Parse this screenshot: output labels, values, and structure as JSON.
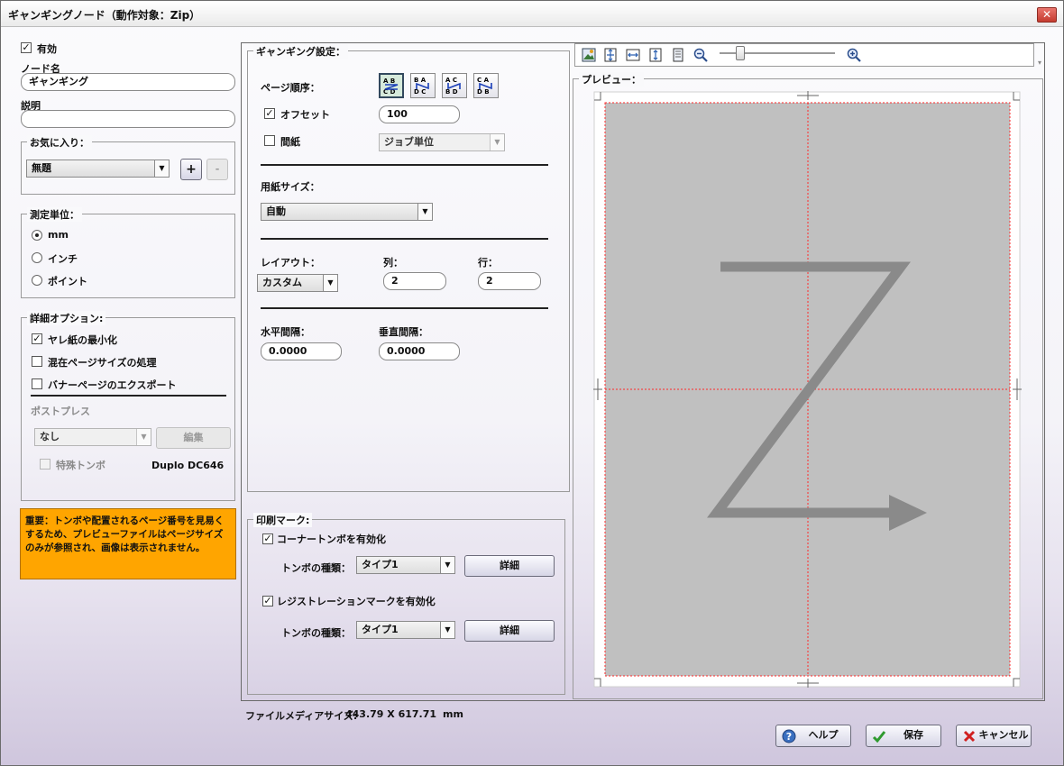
{
  "window": {
    "title": "ギャンギングノード（動作対象：Zip）",
    "close": "✕"
  },
  "left": {
    "enabled_label": "有効",
    "node_name_label": "ノード名",
    "node_name_value": "ギャンギング",
    "description_label": "説明",
    "description_value": "",
    "favorites": {
      "legend": "お気に入り：",
      "selected": "無題",
      "add": "+",
      "remove": "-"
    },
    "units": {
      "legend": "測定単位：",
      "options": [
        "mm",
        "インチ",
        "ポイント"
      ],
      "selected": "mm"
    },
    "advanced": {
      "legend": "詳細オプション:",
      "options": [
        {
          "label": "ヤレ紙の最小化",
          "checked": true
        },
        {
          "label": "混在ページサイズの処理",
          "checked": false
        },
        {
          "label": "バナーページのエクスポート",
          "checked": false
        }
      ],
      "postpress_label": "ポストプレス",
      "postpress_value": "なし",
      "edit_button": "編集",
      "special_trim_label": "特殊トンボ",
      "device_name": "Duplo DC646"
    },
    "notice": "重要：トンボや配置されるページ番号を見易くするため、プレビューファイルはページサイズのみが参照され、画像は表示されません。"
  },
  "ganging": {
    "legend": "ギャンギング設定：",
    "page_order_label": "ページ順序：",
    "page_order_icons": [
      "page-order-z-icon",
      "page-order-n-icon",
      "page-order-reverse-n-icon",
      "page-order-reverse-z-icon"
    ],
    "offset_label": "オフセット",
    "offset_value": "100",
    "slip_label": "間紙",
    "slip_value": "ジョブ単位",
    "paper_size_label": "用紙サイズ：",
    "paper_size_value": "自動",
    "layout_label": "レイアウト：",
    "layout_value": "カスタム",
    "cols_label": "列：",
    "cols_value": "2",
    "rows_label": "行：",
    "rows_value": "2",
    "h_gap_label": "水平間隔：",
    "h_gap_value": "0.0000",
    "v_gap_label": "垂直間隔：",
    "v_gap_value": "0.0000"
  },
  "print_marks": {
    "legend": "印刷マーク:",
    "corner_label": "コーナートンボを有効化",
    "corner_type_label": "トンボの種類：",
    "corner_type_value": "タイプ1",
    "detail_label": "詳細",
    "reg_label": "レジストレーションマークを有効化",
    "reg_type_label": "トンボの種類：",
    "reg_type_value": "タイプ1",
    "detail2_label": "詳細"
  },
  "preview": {
    "legend": "プレビュー：",
    "toolbar_icons": [
      "image-icon",
      "fit-page-icon",
      "fit-width-icon",
      "fit-height-icon",
      "single-page-icon",
      "zoom-out-icon",
      "zoom-in-icon"
    ],
    "zoom_level": 0.15
  },
  "footer": {
    "media_size_label": "ファイルメディアサイズ:",
    "media_size_value": "443.79 X 617.71",
    "media_unit": "mm",
    "help": "ヘルプ",
    "save": "保存",
    "cancel": "キャンセル"
  },
  "colors": {
    "notice_bg": "#ffa500",
    "selected_order_bg": "#d6eadb",
    "guide_line": "#ff2a2a",
    "page_gray": "#c0c0c0"
  }
}
